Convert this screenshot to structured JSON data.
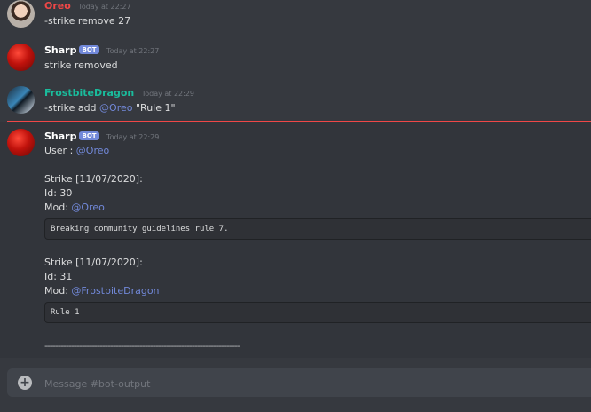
{
  "messages": [
    {
      "author": "Oreo",
      "author_color": "#f04747",
      "bot": false,
      "timestamp": "Today at 22:27",
      "text": "-strike remove 27"
    },
    {
      "author": "Sharp",
      "author_color": "#ffffff",
      "bot": true,
      "bot_tag": "BOT",
      "timestamp": "Today at 22:27",
      "text": "strike removed"
    },
    {
      "author": "FrostbiteDragon",
      "author_color": "#1abc9c",
      "bot": false,
      "timestamp": "Today at 22:29",
      "text_prefix": "-strike add ",
      "mention": "@Oreo",
      "text_suffix": " \"Rule 1\""
    },
    {
      "author": "Sharp",
      "author_color": "#ffffff",
      "bot": true,
      "bot_tag": "BOT",
      "timestamp": "Today at 22:29",
      "user_label": "User : ",
      "user_mention": "@Oreo",
      "strikes": [
        {
          "header": "Strike [11/07/2020]:",
          "id": "Id: 30",
          "mod_label": "Mod: ",
          "mod_mention": "@Oreo",
          "reason": "Breaking community guidelines rule 7."
        },
        {
          "header": "Strike [11/07/2020]:",
          "id": "Id: 31",
          "mod_label": "Mod: ",
          "mod_mention": "@FrostbiteDragon",
          "reason": "Rule 1"
        }
      ],
      "separator": "--------------------------------------------------------------------------"
    }
  ],
  "composer": {
    "placeholder": "Message #bot-output",
    "plus_icon": "add-attachment-icon"
  },
  "colors": {
    "background": "#36393f",
    "mention": "#7289da",
    "bot_tag": "#7289da",
    "new_divider": "#f04747"
  }
}
